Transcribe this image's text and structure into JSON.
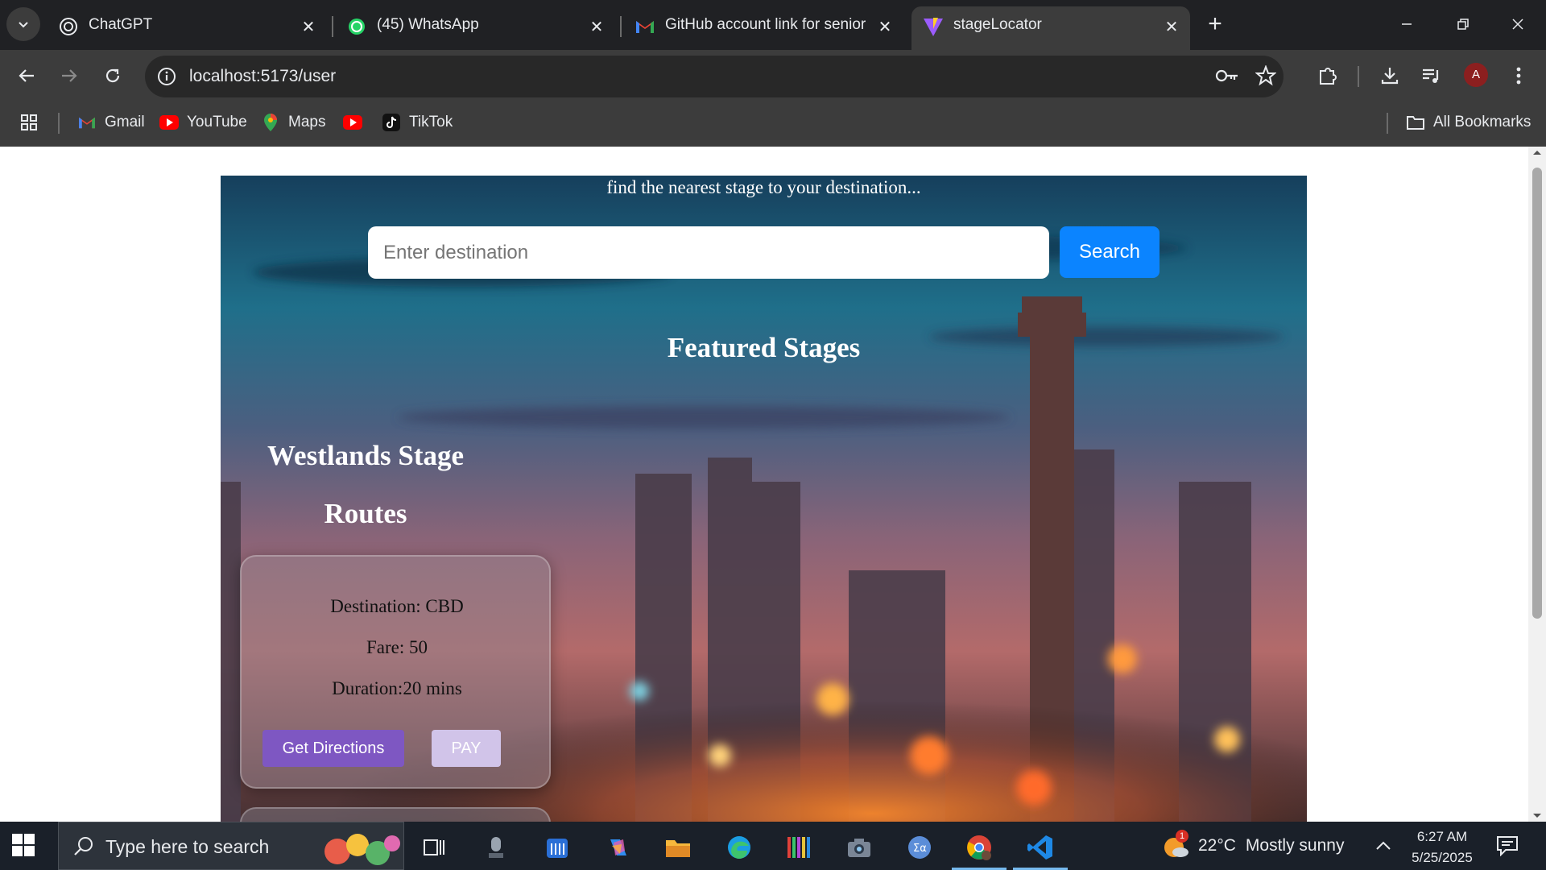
{
  "browser": {
    "tabs": [
      {
        "title": "ChatGPT",
        "icon": "chatgpt-icon"
      },
      {
        "title": "(45) WhatsApp",
        "icon": "whatsapp-icon"
      },
      {
        "title": "GitHub account link for senior p",
        "icon": "gmail-icon"
      },
      {
        "title": "stageLocator",
        "icon": "vite-icon",
        "active": true
      }
    ],
    "url": "localhost:5173/user",
    "avatar_letter": "A",
    "bookmarks": [
      {
        "label": "Gmail",
        "icon": "gmail-icon"
      },
      {
        "label": "YouTube",
        "icon": "youtube-icon"
      },
      {
        "label": "Maps",
        "icon": "maps-icon"
      },
      {
        "label": "",
        "icon": "youtube-icon"
      },
      {
        "label": "TikTok",
        "icon": "tiktok-icon"
      }
    ],
    "all_bookmarks": "All Bookmarks"
  },
  "page": {
    "tagline": "find the nearest stage to your destination...",
    "search_placeholder": "Enter destination",
    "search_button": "Search",
    "featured_title": "Featured Stages",
    "stage_name": "Westlands Stage",
    "routes_title": "Routes",
    "route": {
      "destination": "Destination: CBD",
      "fare": "Fare: 50",
      "duration": "Duration:20 mins",
      "directions_button": "Get Directions",
      "pay_button": "PAY"
    }
  },
  "taskbar": {
    "search_placeholder": "Type here to search",
    "weather_temp": "22°C",
    "weather_desc": "Mostly sunny",
    "weather_badge": "1",
    "time": "6:27 AM",
    "date": "5/25/2025"
  },
  "colors": {
    "primary_button": "#0b84ff",
    "directions_button": "#7e57c2",
    "pay_button": "#d1c4e9"
  }
}
